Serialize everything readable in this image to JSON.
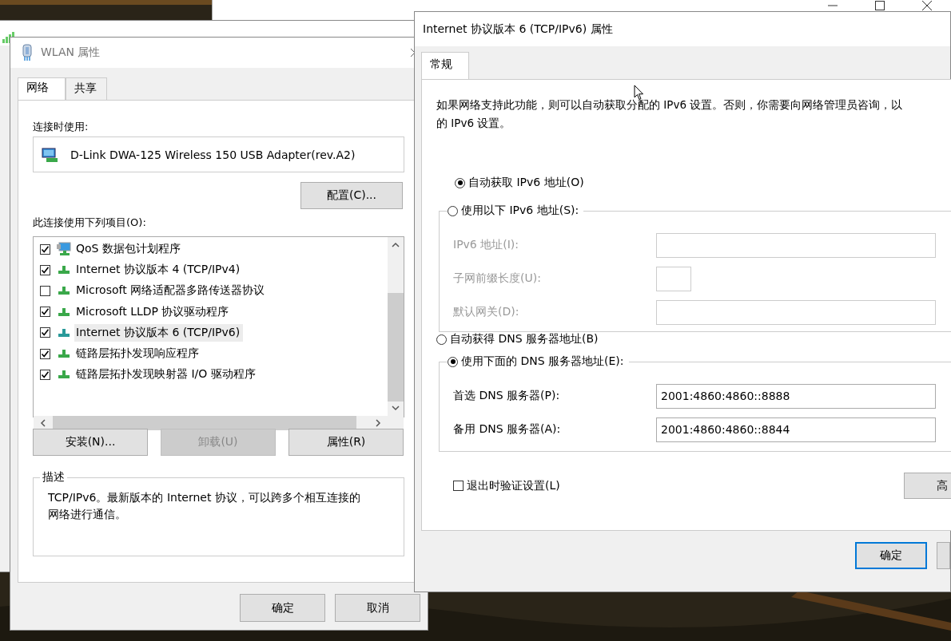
{
  "properties_window": {
    "title": "WLAN 属性",
    "tabs": [
      {
        "label": "网络",
        "selected": true
      },
      {
        "label": "共享",
        "selected": false
      }
    ],
    "connect_using_label": "连接时使用:",
    "adapter": "D-Link DWA-125 Wireless 150 USB Adapter(rev.A2)",
    "configure_button": "配置(C)...",
    "items_label": "此连接使用下列项目(O):",
    "items": [
      {
        "label": "QoS 数据包计划程序",
        "checked": true,
        "selected": false,
        "kind": "monitor"
      },
      {
        "label": "Internet 协议版本 4 (TCP/IPv4)",
        "checked": true,
        "selected": false,
        "kind": "protocol"
      },
      {
        "label": "Microsoft 网络适配器多路传送器协议",
        "checked": false,
        "selected": false,
        "kind": "protocol"
      },
      {
        "label": "Microsoft LLDP 协议驱动程序",
        "checked": true,
        "selected": false,
        "kind": "protocol"
      },
      {
        "label": "Internet 协议版本 6 (TCP/IPv6)",
        "checked": true,
        "selected": true,
        "kind": "protocol"
      },
      {
        "label": "链路层拓扑发现响应程序",
        "checked": true,
        "selected": false,
        "kind": "protocol"
      },
      {
        "label": "链路层拓扑发现映射器 I/O 驱动程序",
        "checked": true,
        "selected": false,
        "kind": "protocol"
      }
    ],
    "item_buttons": [
      {
        "label": "安装(N)...",
        "disabled": false
      },
      {
        "label": "卸载(U)",
        "disabled": true
      },
      {
        "label": "属性(R)",
        "disabled": false
      }
    ],
    "description": {
      "title": "描述",
      "lines": [
        "TCP/IPv6。最新版本的 Internet 协议，可以跨多个相互连接的",
        "网络进行通信。"
      ]
    },
    "dialog_buttons": [
      "确定",
      "取消"
    ]
  },
  "ipv6_window": {
    "title": "Internet 协议版本 6 (TCP/IPv6) 属性",
    "tabs": [
      {
        "label": "常规",
        "selected": true
      }
    ],
    "intro_lines": [
      "如果网络支持此功能，则可以自动获取分配的 IPv6 设置。否则，你需要向网络管理员咨询，以",
      "的 IPv6 设置。"
    ],
    "ip_options": [
      {
        "label": "自动获取 IPv6 地址(O)",
        "selected": true
      },
      {
        "label": "使用以下 IPv6 地址(S):",
        "selected": false
      }
    ],
    "ip_fields": [
      {
        "label": "IPv6 地址(I):",
        "disabled": true,
        "kind": "wide"
      },
      {
        "label": "子网前缀长度(U):",
        "disabled": true,
        "kind": "short"
      },
      {
        "label": "默认网关(D):",
        "disabled": true,
        "kind": "wide"
      }
    ],
    "dns_options": [
      {
        "label": "自动获得 DNS 服务器地址(B)",
        "selected": false
      },
      {
        "label": "使用下面的 DNS 服务器地址(E):",
        "selected": true
      }
    ],
    "dns_fields": [
      {
        "label": "首选 DNS 服务器(P):",
        "value": "2001:4860:4860::8888",
        "disabled": false
      },
      {
        "label": "备用 DNS 服务器(A):",
        "value": "2001:4860:4860::8844",
        "disabled": false
      }
    ],
    "validate_checkbox": {
      "label": "退出时验证设置(L)",
      "checked": false
    },
    "advanced_button": "高",
    "ok_button": "确定"
  }
}
